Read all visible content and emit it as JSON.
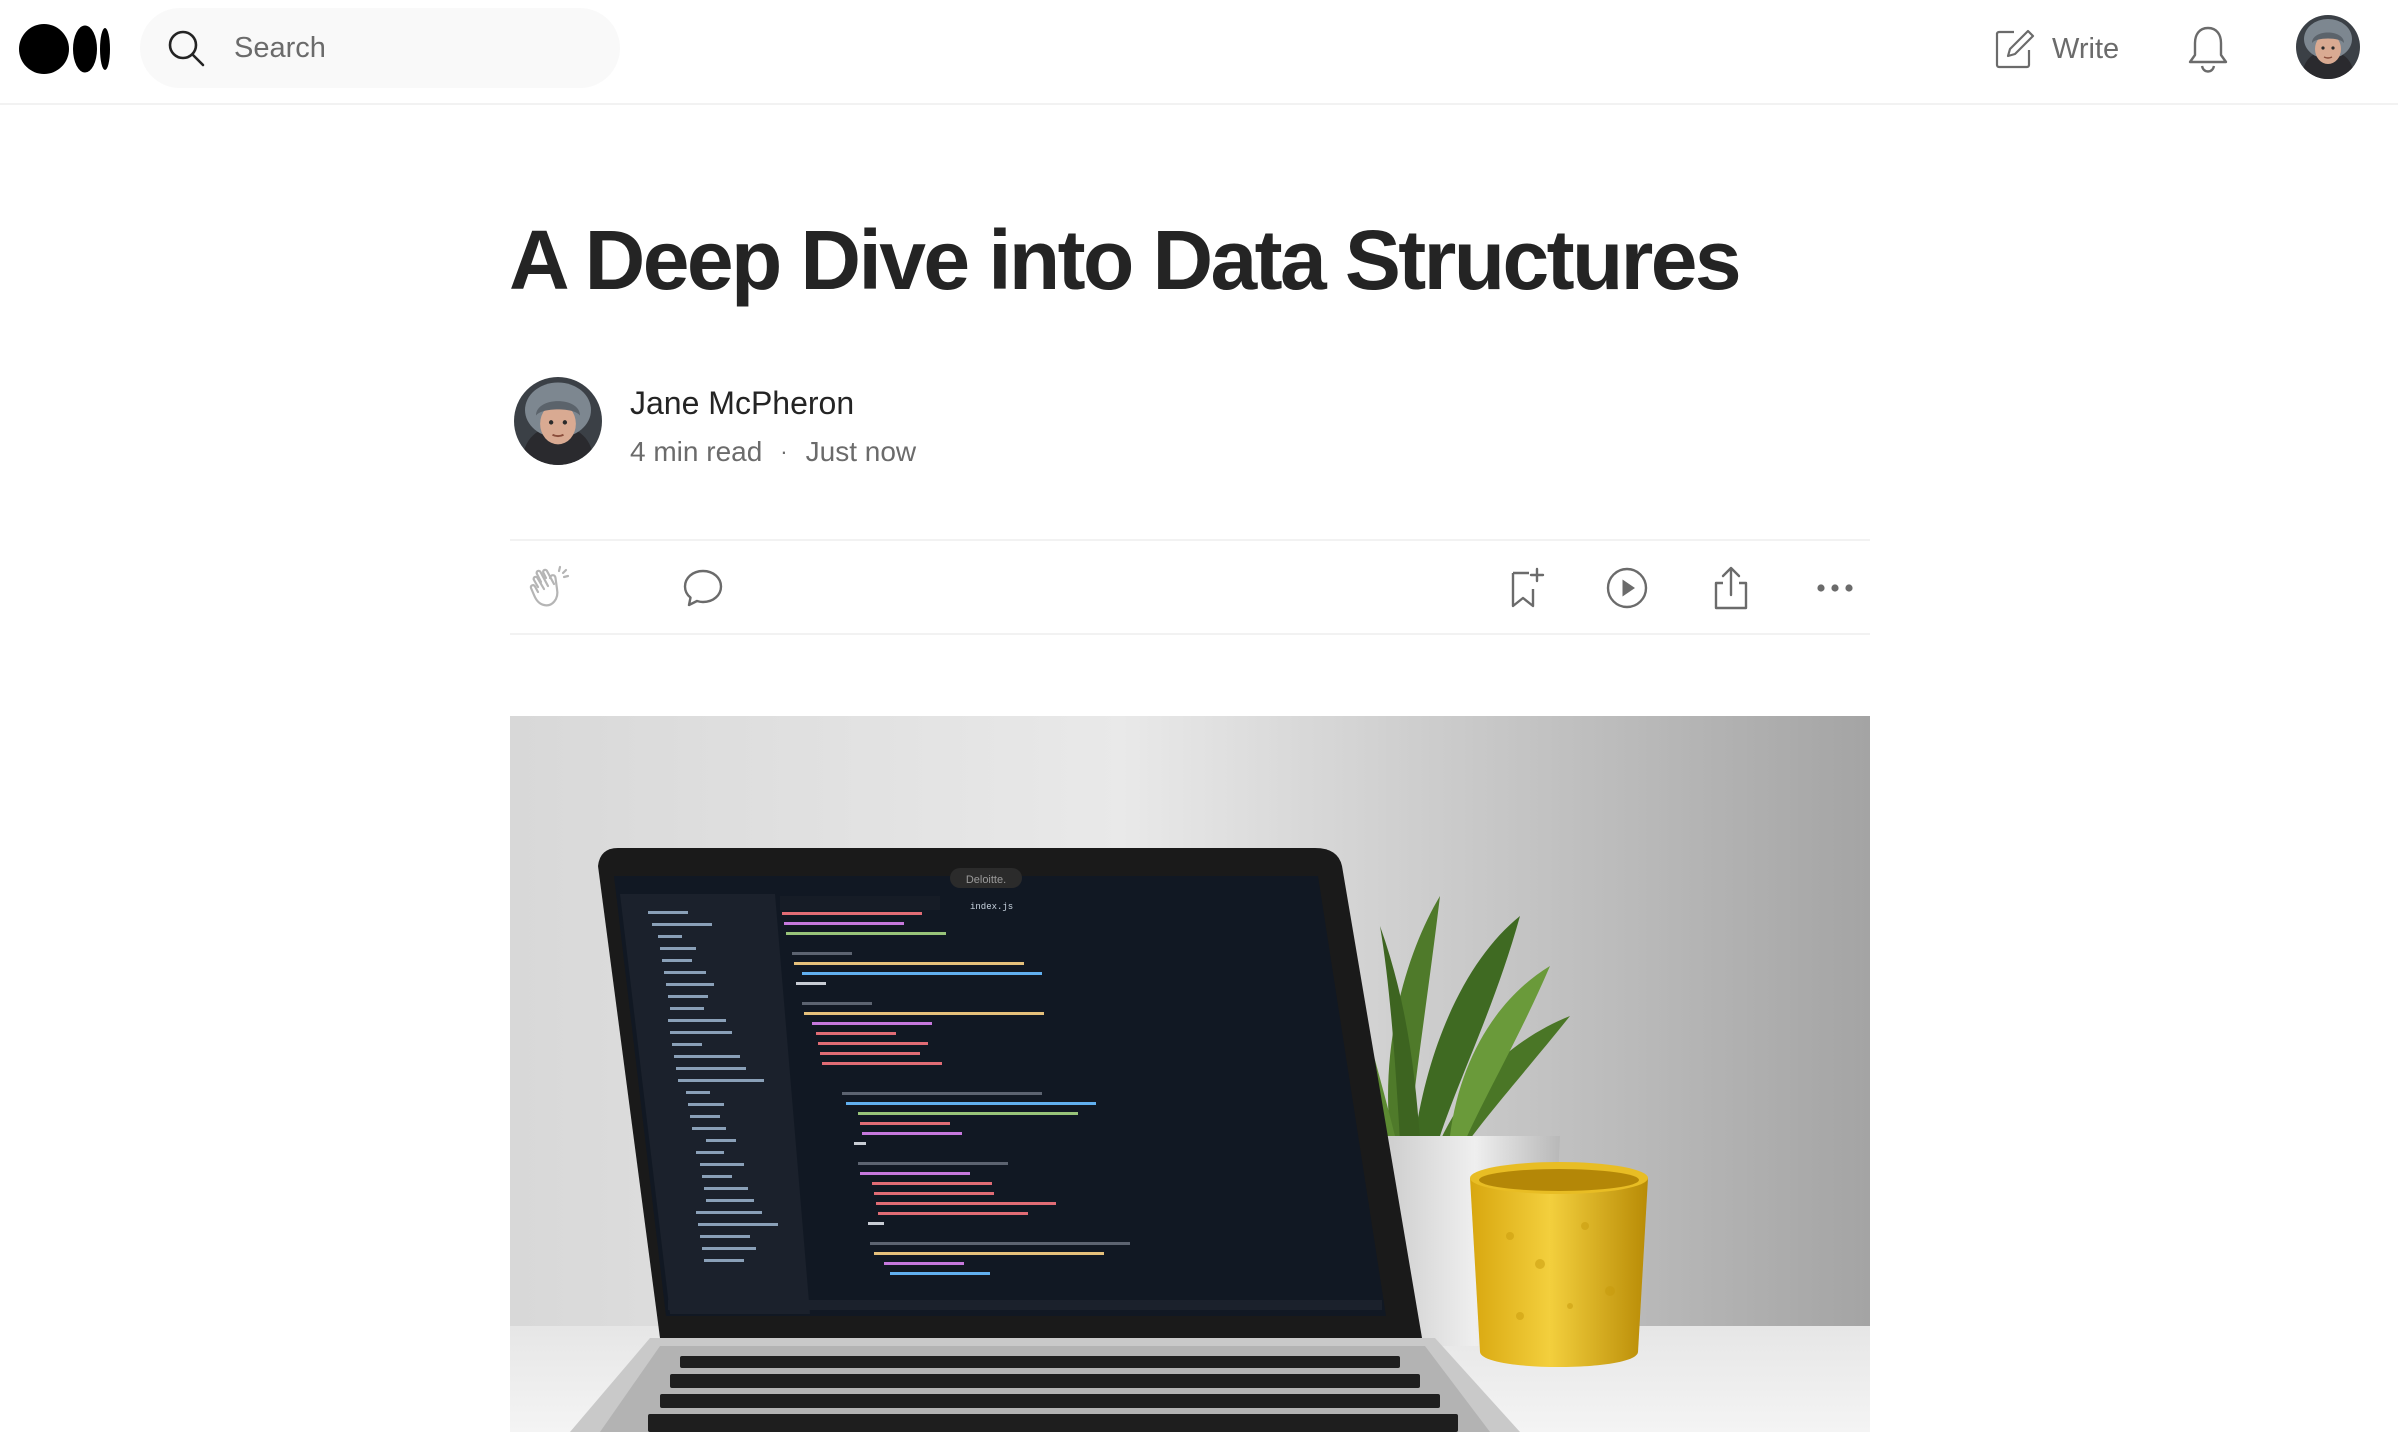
{
  "nav": {
    "logo_icon": "medium-logo-icon",
    "search": {
      "placeholder": "Search",
      "icon": "search-icon"
    },
    "write_label": "Write",
    "write_icon": "write-icon",
    "notifications_icon": "bell-icon",
    "avatar_icon": "user-avatar"
  },
  "article": {
    "title": "A Deep Dive into Data Structures",
    "author": {
      "name": "Jane McPheron",
      "read_time": "4 min read",
      "separator": "·",
      "published": "Just now"
    },
    "actions": {
      "clap_icon": "clap-icon",
      "comment_icon": "comment-icon",
      "bookmark_icon": "bookmark-add-icon",
      "listen_icon": "play-icon",
      "share_icon": "share-icon",
      "more_icon": "more-icon"
    },
    "hero_image": {
      "subject": "laptop-with-code-photo",
      "sticker_text": "Deloitte.",
      "editor_tab": "index.js"
    }
  },
  "colors": {
    "text_primary": "#242424",
    "text_secondary": "#6b6b6b",
    "search_bg": "#f9f9f9",
    "divider": "#f2f2f2"
  }
}
